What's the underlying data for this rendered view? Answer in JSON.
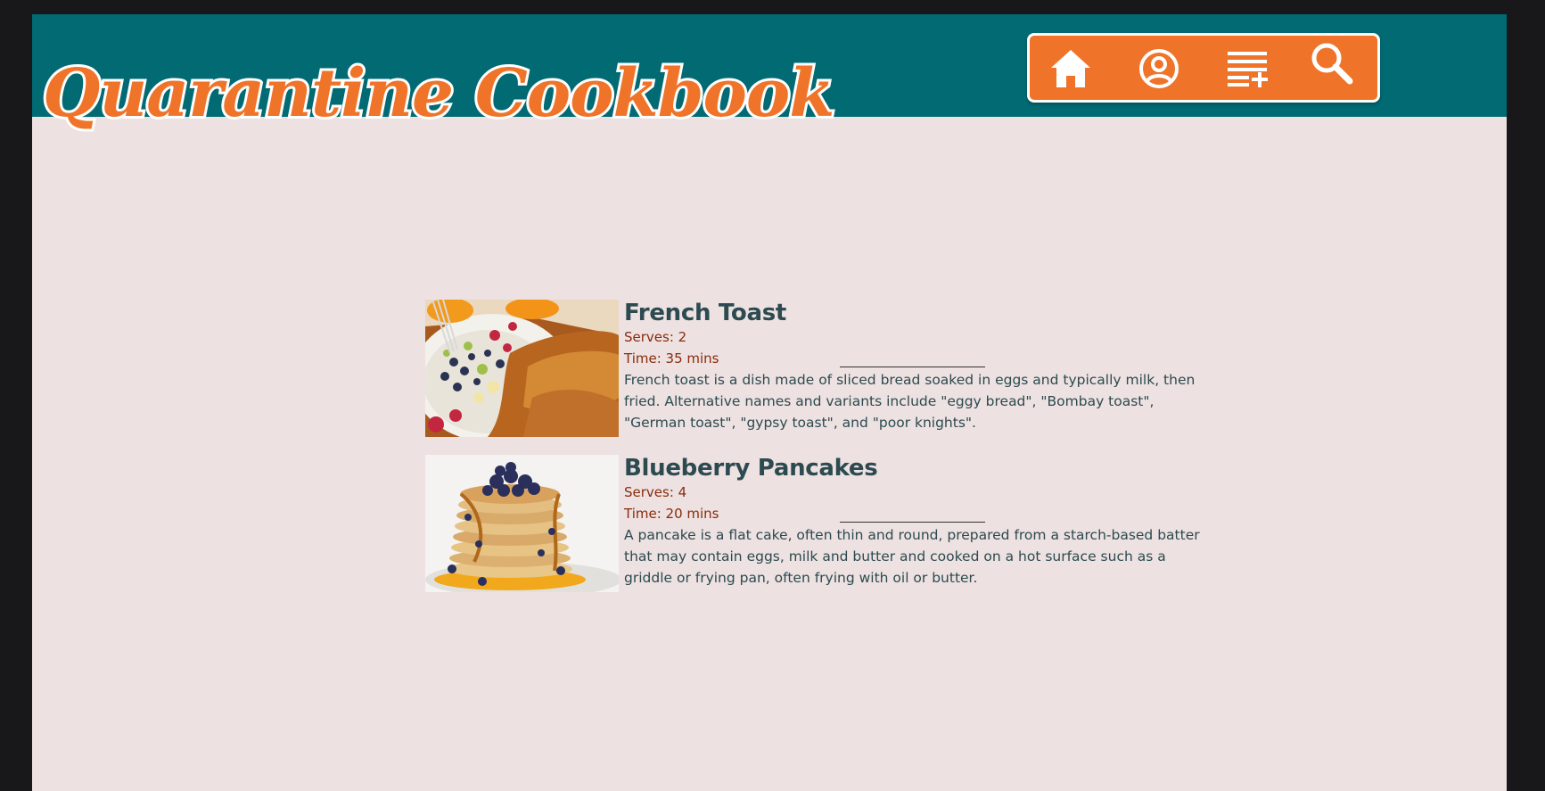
{
  "app": {
    "title": "Quarantine Cookbook"
  },
  "nav": {
    "items": [
      {
        "icon": "home-icon",
        "label": "Home"
      },
      {
        "icon": "profile-icon",
        "label": "Profile"
      },
      {
        "icon": "add-recipe-icon",
        "label": "Add recipe"
      },
      {
        "icon": "search-icon",
        "label": "Search"
      }
    ]
  },
  "colors": {
    "header": "#016a73",
    "accent": "#ef7429",
    "background": "#ede1e1",
    "title_text": "#2c4a4f",
    "meta_text": "#8a2c0c"
  },
  "recipes": [
    {
      "title": "French Toast",
      "serves": "Serves: 2",
      "time": "Time: 35 mins",
      "description": "French toast is a dish made of sliced bread soaked in eggs and typically milk, then fried. Alternative names and variants include \"eggy bread\", \"Bombay toast\", \"German toast\", \"gypsy toast\", and \"poor knights\"."
    },
    {
      "title": "Blueberry Pancakes",
      "serves": "Serves: 4",
      "time": "Time: 20 mins",
      "description": "A pancake is a flat cake, often thin and round, prepared from a starch-based batter that may contain eggs, milk and butter and cooked on a hot surface such as a griddle or frying pan, often frying with oil or butter."
    }
  ]
}
